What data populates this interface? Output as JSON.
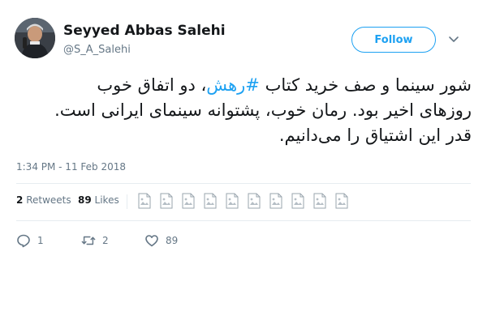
{
  "author": {
    "name": "Seyyed Abbas Salehi",
    "handle": "@S_A_Salehi"
  },
  "follow_label": "Follow",
  "tweet": {
    "line1_pre": "شور سینما و صف خرید کتاب ",
    "hashtag": "#رهش",
    "line1_post": "، دو اتفاق خوب",
    "line2": "روزهای اخیر بود. رمان خوب، پشتوانه سینمای ایرانی است.",
    "line3": "قدر این اشتیاق را می‌دانیم."
  },
  "timestamp": "1:34 PM - 11 Feb 2018",
  "stats": {
    "retweets_count": "2",
    "retweets_label": "Retweets",
    "likes_count": "89",
    "likes_label": "Likes"
  },
  "actions": {
    "reply_count": "1",
    "retweet_count": "2",
    "like_count": "89"
  },
  "colors": {
    "accent": "#1da1f2",
    "muted": "#657786",
    "divider": "#e6ecf0"
  }
}
